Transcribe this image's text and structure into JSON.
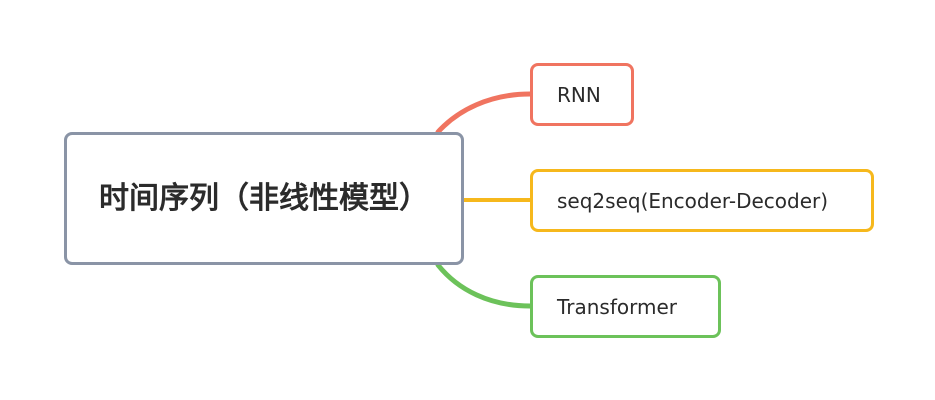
{
  "root": {
    "title": "时间序列（非线性模型）",
    "border_color": "#8a94a6"
  },
  "children": [
    {
      "label": "RNN",
      "color": "#f07460"
    },
    {
      "label": "seq2seq(Encoder-Decoder)",
      "color": "#f6b81c"
    },
    {
      "label": "Transformer",
      "color": "#6cc25a"
    }
  ]
}
